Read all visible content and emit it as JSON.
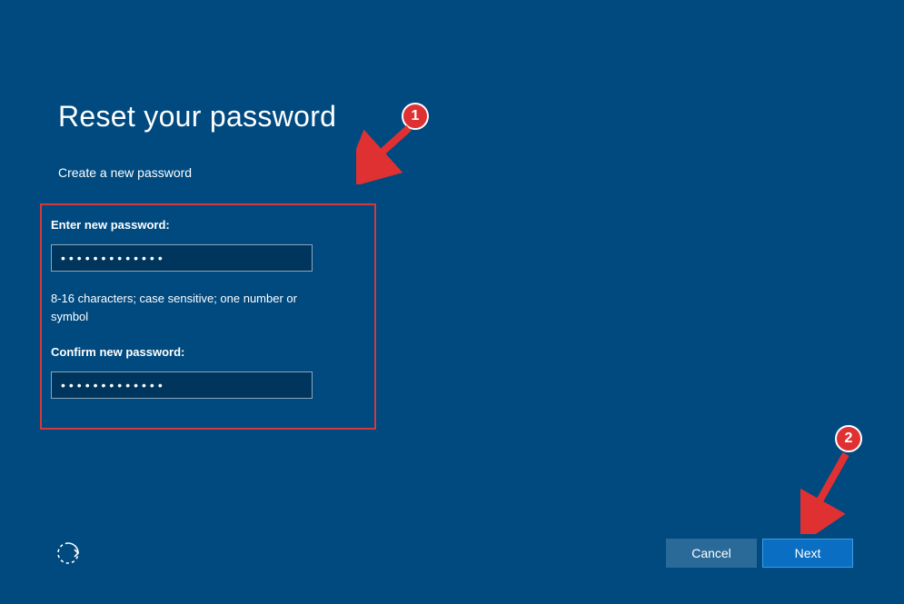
{
  "colors": {
    "background": "#004a80",
    "input_bg": "#00365e",
    "annotation_red": "#e03132",
    "highlight_border": "#d33a3d",
    "btn_cancel": "#2a6a99",
    "btn_next": "#0a6fc2"
  },
  "page": {
    "title": "Reset your password",
    "subtitle": "Create a new password"
  },
  "form": {
    "enter_label": "Enter new password:",
    "enter_value": "•••••••••••••",
    "hint": "8-16 characters; case sensitive; one number or symbol",
    "confirm_label": "Confirm new password:",
    "confirm_value": "•••••••••••••"
  },
  "footer": {
    "cancel_label": "Cancel",
    "next_label": "Next"
  },
  "annotations": {
    "badge1": "1",
    "badge2": "2"
  }
}
